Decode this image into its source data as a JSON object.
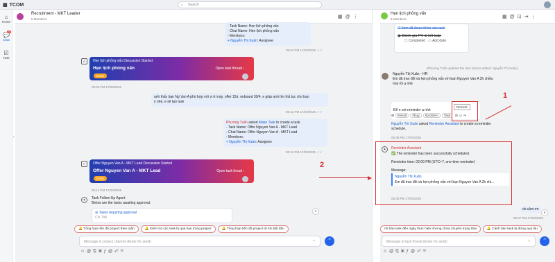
{
  "app": {
    "title": "TCOM",
    "search_placeholder": "Search"
  },
  "nav": {
    "home": "Home",
    "chat": "Chat",
    "chat_badge": "20",
    "task": "Task"
  },
  "left": {
    "title": "Recruitment - MKT Leader",
    "members": "5 Members",
    "msg1": {
      "l1": "- Task Name: Hẹn lịch phỏng vấn",
      "l2": "- Chat Name: Hẹn lịch phỏng vấn",
      "l3": "- Members:",
      "l4_user": "+ Nguyễn Thị Xuân",
      "l4_role": ": Assignee",
      "time": "05:03 PM 17/03/2026"
    },
    "card1": {
      "caption": "Hẹn lịch phỏng vấn Discussion Started",
      "title": "Hẹn lịch phỏng vấn",
      "status": "Done",
      "open": "Open task thread",
      "time": "05:03 PM 17/03/2026"
    },
    "msg2": {
      "text1": "anh thấy bạn Ng Van A phù hợp với vị trí này, offer 15tr, onboard 30/4, e giúp anh tìm thủ tục cho bạn",
      "text2": "ý nhé, e sẽ tạo task",
      "time": "05:12 PM 17/03/2026"
    },
    "msg3": {
      "actor": "Phương Tuấn",
      "mid": " asked ",
      "link": "Make Task",
      "rest": " to create a task",
      "l1": "- Task Name: Offer Nguyen Van A - MKT Lead",
      "l2": "- Chat Name: Offer Nguyen Van A - MKT Lead",
      "l3": "- Members:",
      "l4_user": "+ Nguyễn Thị Xuân",
      "l4_role": ": Assignee",
      "time": "05:12 PM 17/03/2026"
    },
    "card2": {
      "caption": "Offer Nguyen Van A - MKT Lead Discussion Started",
      "title": "Offer Nguyen Van A - MKT Lead",
      "status": "Done",
      "open": "Open task thead",
      "time": "05:12 PM 17/03/2026"
    },
    "agent": {
      "name": "Task Follow-Up Agent",
      "text": "Below are the tasks awaiting approval.",
      "req": "Tasks requiring approval",
      "more": "Chi Tiết"
    },
    "chips": [
      "Tổng hợp tiến độ project theo tuần",
      "Kiểm tra các task bị quá hạn trong project",
      "Tổng hợp tiến độ project từ khi bắt đầu"
    ],
    "input_placeholder": "Message in project channel (Enter for send)"
  },
  "right": {
    "title": "Hẹn lịch phỏng vấn",
    "members": "5 Members",
    "check1": "Item đã được thêm vào task",
    "check2": "Đánh giá PV & kết luận",
    "completed": "Completed",
    "add_date": "Add date",
    "sys_note": "(Phương Tuấn updated the item (Users added: Nguyễn Thị Xuân)",
    "hr": {
      "name": "Nguyễn Thị Xuân - HR",
      "text1": "Em đã trao đổi và hẹn phỏng vấn với bạn Nguyen Van A 2h chiều",
      "text2": "mai rồi a nhé"
    },
    "set": {
      "text": "Để e set reminder ạ nhé",
      "tooltip": "Remind"
    },
    "tags": [
      "#result",
      "#bug",
      "#problem",
      "Task"
    ],
    "asked": {
      "actor": "Nguyễn Thị Xuân",
      "mid": " asked ",
      "link": "Reminder Assistant",
      "rest": " to create a reminder",
      "rest2": "schedule.",
      "time": "05:08 PM 17/03/2026"
    },
    "assistant": {
      "name": "Reminder Assistant",
      "ok": "✅ The reminder has been successfully scheduled.",
      "reminder": "Reminder time: 02:00 PM (UTC+7, one-time reminder)",
      "msg_label": "Message:",
      "quote_user": "Nguyễn Thị Xuân",
      "quote_text": "Em đã trao đổi và hẹn phỏng vấn với bạn Nguyen Van A 2h chi...",
      "time": "05:08 PM 17/03/2026"
    },
    "ok_msg": "ok cảm ơn",
    "ok_time": "05:07 PM 17/03/2026",
    "chips": [
      "nh báo task đến ngày thực hiện nhưng chưa chuyển trạng thái",
      "Cảnh báo task bị đứng quá lâu"
    ],
    "input_placeholder": "Message in task thread (Enter for send)"
  },
  "annotations": {
    "one": "1",
    "two": "2"
  },
  "colors": {
    "accent": "#2563eb",
    "annotation": "#d32f2f",
    "card_from": "#1f3fb0",
    "card_to": "#e63946"
  }
}
